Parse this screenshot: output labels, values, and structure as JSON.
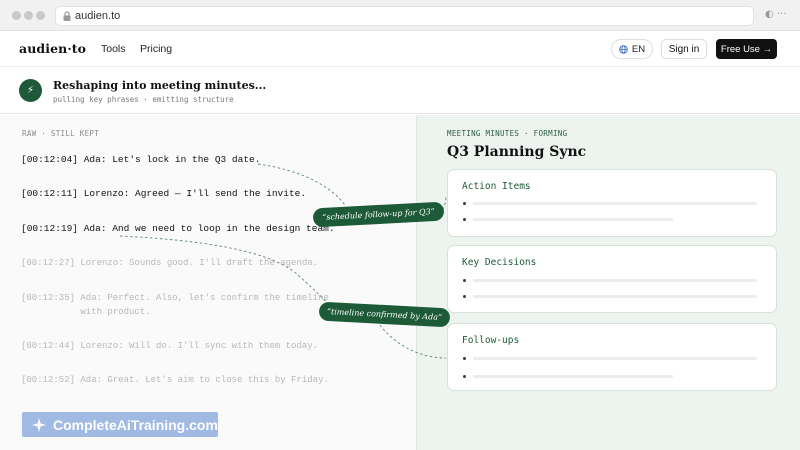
{
  "browser": {
    "url": "audien.to"
  },
  "nav": {
    "brand": "audien·to",
    "links": [
      "Tools",
      "Pricing"
    ],
    "language": "EN",
    "signin": "Sign in",
    "cta": "Free Use →"
  },
  "status": {
    "title": "Reshaping into meeting minutes...",
    "subtitle": "pulling key phrases · emitting structure"
  },
  "raw": {
    "label": "RAW · STILL KEPT",
    "lines": [
      {
        "text": "[00:12:04] Ada: Let's lock in the Q3 date.",
        "state": "kept"
      },
      {
        "text": "[00:12:11] Lorenzo: Agreed — I'll send the invite.",
        "state": "kept"
      },
      {
        "text": "[00:12:19] Ada: And we need to loop in the design team.",
        "state": "kept"
      },
      {
        "text": "[00:12:27] Lorenzo: Sounds good. I'll draft the agenda.",
        "state": "faded"
      },
      {
        "text": "[00:12:35] Ada: Perfect. Also, let's confirm the timeline",
        "state": "faded"
      },
      {
        "text": "           with product.",
        "state": "faded"
      },
      {
        "text": "[00:12:44] Lorenzo: Will do. I'll sync with them today.",
        "state": "faded"
      },
      {
        "text": "[00:12:52] Ada: Great. Let's aim to close this by Friday.",
        "state": "faded"
      }
    ]
  },
  "minutes": {
    "label": "MEETING MINUTES · FORMING",
    "title": "Q3 Planning Sync",
    "sections": [
      {
        "title": "Action Items"
      },
      {
        "title": "Key Decisions"
      },
      {
        "title": "Follow-ups"
      }
    ]
  },
  "tags": {
    "tag1": "“schedule follow-up for Q3”",
    "tag2": "“timeline confirmed by Ada”"
  },
  "watermark": {
    "text": "CompleteAiTraining.com"
  },
  "colors": {
    "accent_green": "#1d5a37",
    "panel_green": "#edf3ee",
    "watermark_blue": "#9db7e3"
  }
}
